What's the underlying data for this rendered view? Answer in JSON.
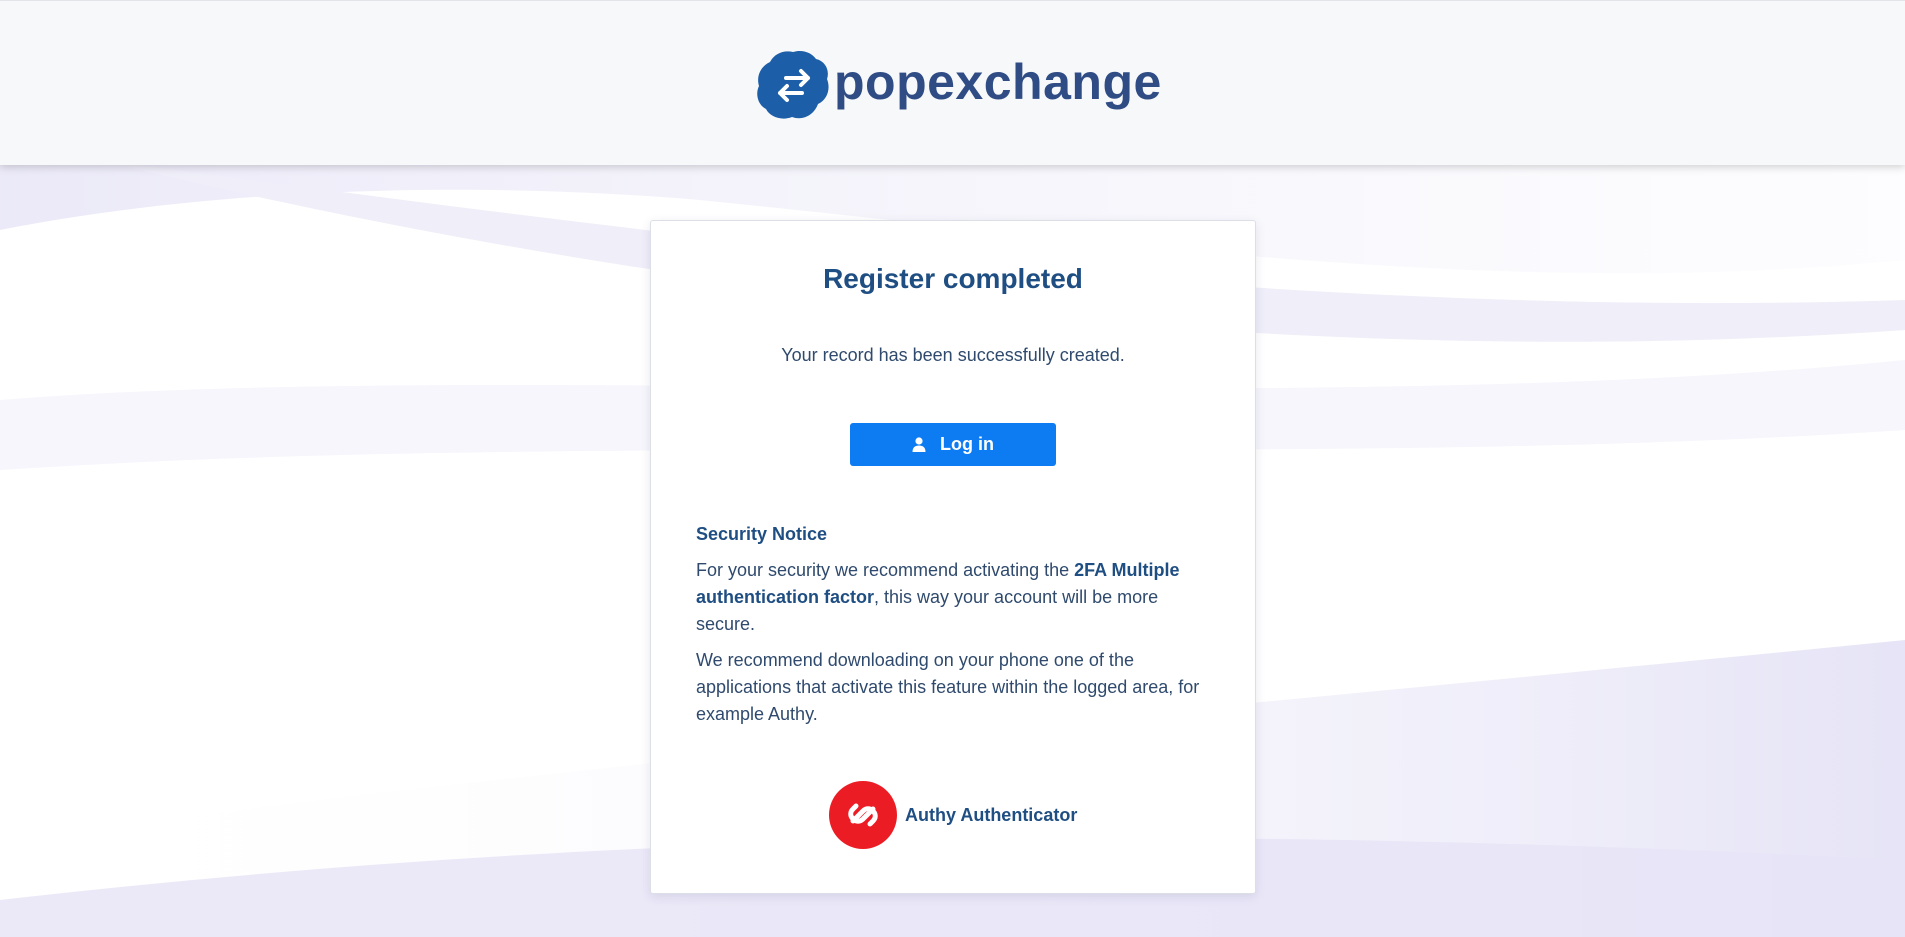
{
  "brand": {
    "name": "popexchange",
    "logo_icon": "exchange-arrows-icon",
    "color": "#2f4c85",
    "mark_color": "#1d5ea8"
  },
  "card": {
    "title": "Register completed",
    "subtitle": "Your record has been successfully created.",
    "login_button": {
      "label": "Log in",
      "icon": "user-icon",
      "color": "#0d7cf2"
    },
    "security_notice": {
      "title": "Security Notice",
      "p1_before": "For your security we recommend activating the ",
      "p1_bold": "2FA Multiple authentication factor",
      "p1_after": ", this way your account will be more secure.",
      "p2": "We recommend downloading on your phone one of the applications that activate this feature within the logged area, for example Authy."
    },
    "authy": {
      "label": "Authy Authenticator",
      "icon": "authy-icon",
      "color": "#ec1c24"
    }
  }
}
